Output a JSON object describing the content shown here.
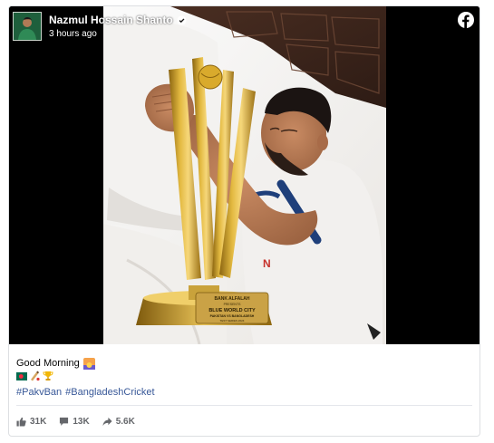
{
  "post": {
    "author": "Nazmul Hossain Shanto",
    "timestamp": "3 hours ago",
    "verified": true,
    "platform_icon": "facebook-icon",
    "caption": {
      "line1": "Good Morning",
      "line1_emoji": "sunrise-emoji",
      "line2_emojis": [
        "bangladesh-flag-emoji",
        "cricket-emoji",
        "trophy-emoji"
      ],
      "hashtags": [
        "#PakvBan",
        "#BangladeshCricket"
      ]
    },
    "trophy_plaque": {
      "brand": "BANK ALFALAH",
      "presents": "PRESENTS",
      "title": "BLUE WORLD CITY",
      "series": "PAKISTAN VS BANGLADESH",
      "subtitle": "TEST SERIES 2024"
    },
    "stats": {
      "likes": "31K",
      "comments": "13K",
      "shares": "5.6K"
    }
  },
  "colors": {
    "link": "#385898",
    "muted": "#65676b",
    "facebook_brand": "#ffffff",
    "verified_badge": "#ffffff"
  }
}
